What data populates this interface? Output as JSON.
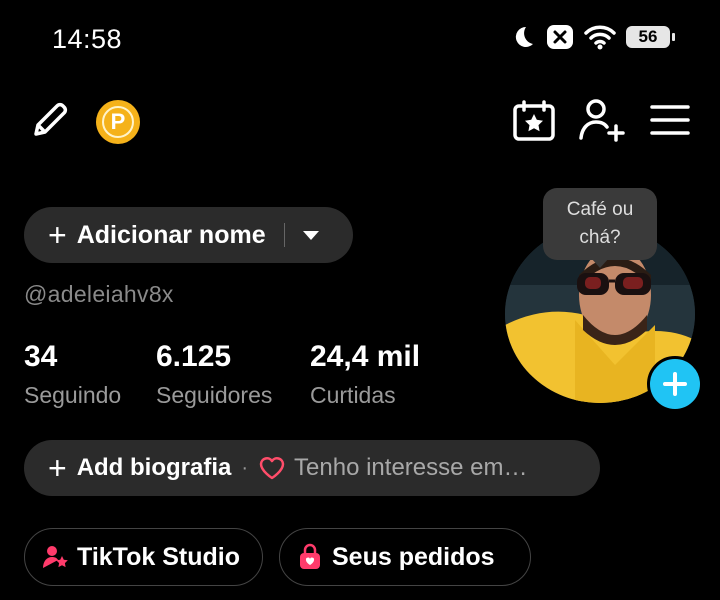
{
  "status_bar": {
    "time": "14:58",
    "battery": "56",
    "icons": [
      "moon-icon",
      "notification-mute-icon",
      "wifi-icon",
      "battery-icon"
    ]
  },
  "top_bar": {
    "icons": [
      "pencil-icon",
      "coin-icon",
      "calendar-star-icon",
      "add-user-icon",
      "menu-icon"
    ],
    "coin_letter": "P",
    "coin_color": "#f5b21a"
  },
  "profile": {
    "add_name_label": "Adicionar nome",
    "username": "@adeleiahv8x",
    "bubble_text": "Café ou chá?",
    "accent": "#20c4f4"
  },
  "stats": [
    {
      "value": "34",
      "label": "Seguindo"
    },
    {
      "value": "6.125",
      "label": "Seguidores"
    },
    {
      "value": "24,4 mil",
      "label": "Curtidas"
    }
  ],
  "bio": {
    "add_label": "Add biografia",
    "separator": "·",
    "interest_text": "Tenho interesse em…",
    "heart_color": "#ff4d6a"
  },
  "chips": [
    {
      "label": "TikTok Studio",
      "icon": "studio-icon"
    },
    {
      "label": "Seus pedidos",
      "icon": "shopping-bag-icon"
    }
  ]
}
